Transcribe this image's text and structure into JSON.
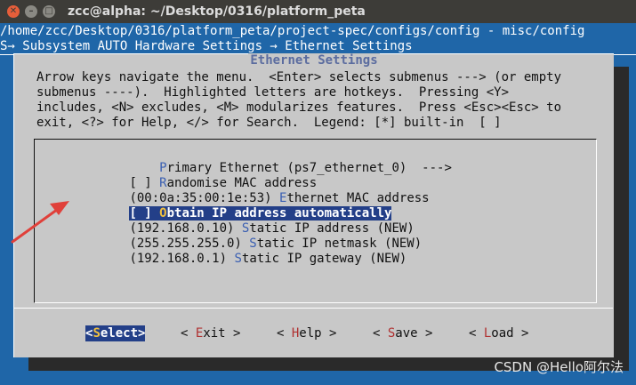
{
  "window": {
    "title": "zcc@alpha: ~/Desktop/0316/platform_peta"
  },
  "terminal": {
    "path_line": "/home/zcc/Desktop/0316/platform_peta/project-spec/configs/config - misc/config",
    "breadcrumb": "S→ Subsystem AUTO Hardware Settings → Ethernet Settings"
  },
  "dialog": {
    "title": "Ethernet Settings",
    "help_lines": [
      "Arrow keys navigate the menu.  <Enter> selects submenus ---> (or empty",
      "submenus ----).  Highlighted letters are hotkeys.  Pressing <Y>",
      "includes, <N> excludes, <M> modularizes features.  Press <Esc><Esc> to",
      "exit, <?> for Help, </> for Search.  Legend: [*] built-in  [ ]"
    ]
  },
  "menu": {
    "items": [
      {
        "prefix": "    ",
        "hotkey": "P",
        "rest": "rimary Ethernet (ps7_ethernet_0)  --->",
        "selected": false
      },
      {
        "prefix": "[ ] ",
        "hotkey": "R",
        "rest": "andomise MAC address",
        "selected": false
      },
      {
        "prefix": "(00:0a:35:00:1e:53) ",
        "hotkey": "E",
        "rest": "thernet MAC address",
        "selected": false
      },
      {
        "prefix": "[ ] ",
        "hotkey": "O",
        "rest": "btain IP address automatically",
        "selected": true
      },
      {
        "prefix": "(192.168.0.10) ",
        "hotkey": "S",
        "rest": "tatic IP address (NEW)",
        "selected": false
      },
      {
        "prefix": "(255.255.255.0) ",
        "hotkey": "S",
        "rest": "tatic IP netmask (NEW)",
        "selected": false
      },
      {
        "prefix": "(192.168.0.1) ",
        "hotkey": "S",
        "rest": "tatic IP gateway (NEW)",
        "selected": false
      }
    ]
  },
  "buttons": {
    "select": {
      "open": "<",
      "hotkey": "S",
      "rest": "elect",
      "close": ">"
    },
    "exit": {
      "open": "< ",
      "hotkey": "E",
      "rest": "xit",
      "close": " >"
    },
    "help": {
      "open": "< ",
      "hotkey": "H",
      "rest": "elp",
      "close": " >"
    },
    "save": {
      "open": "< ",
      "hotkey": "S",
      "rest": "ave",
      "close": " >"
    },
    "load": {
      "open": "< ",
      "hotkey": "L",
      "rest": "oad",
      "close": " >"
    }
  },
  "watermark": "CSDN @Hello阿尔法",
  "colors": {
    "background": "#1f66a8",
    "dialog": "#c8c8c8",
    "highlight": "#233f88",
    "arrow": "#e0403a"
  }
}
